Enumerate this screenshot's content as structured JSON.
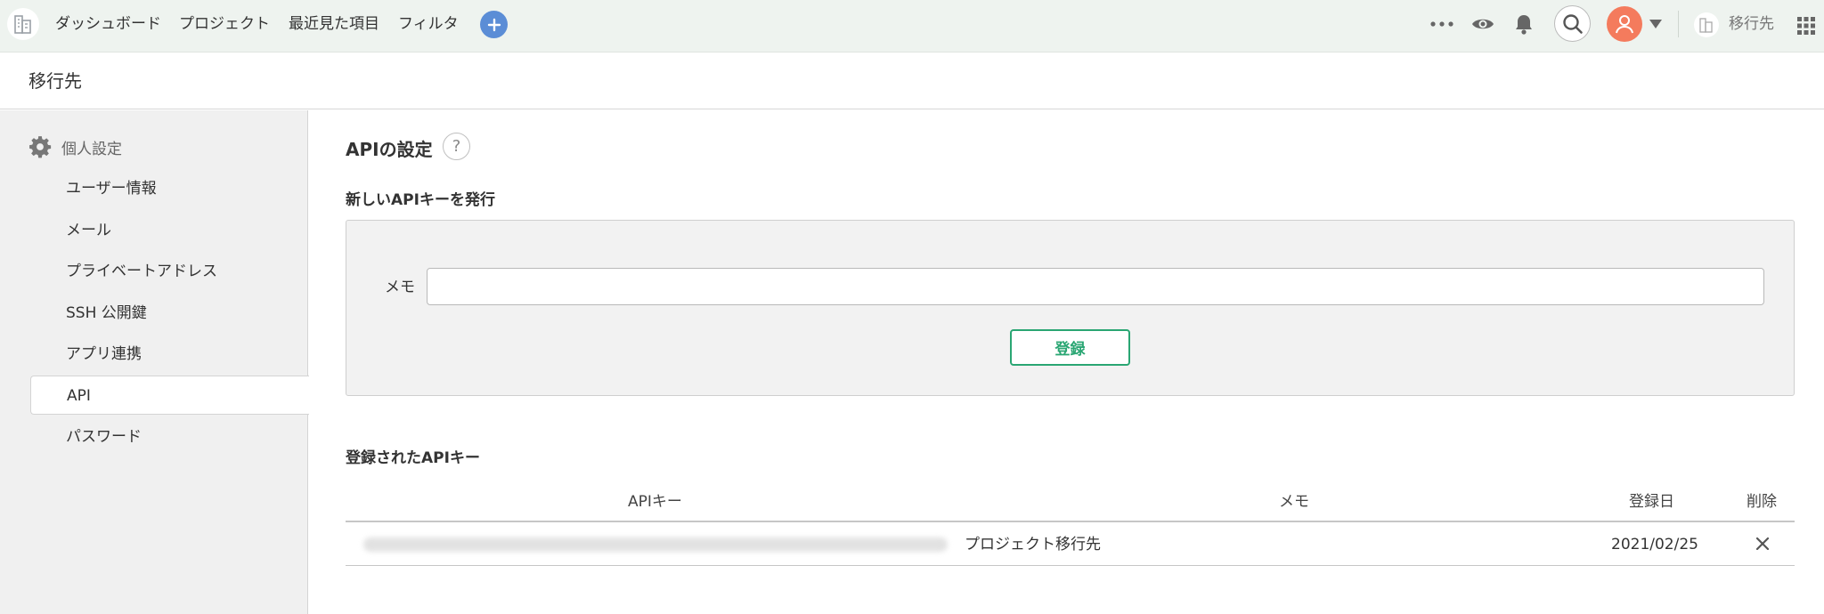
{
  "topbar": {
    "nav": [
      "ダッシュボード",
      "プロジェクト",
      "最近見た項目",
      "フィルタ"
    ],
    "project_name": "移行先",
    "icons": [
      "space-logo-icon",
      "add-icon",
      "more-icon",
      "watch-icon",
      "bell-icon",
      "search-icon",
      "user-avatar-icon",
      "chevron-down-icon",
      "project-icon",
      "apps-grid-icon"
    ]
  },
  "page": {
    "title": "移行先"
  },
  "sidebar": {
    "section": "個人設定",
    "items": [
      {
        "label": "ユーザー情報"
      },
      {
        "label": "メール"
      },
      {
        "label": "プライベートアドレス"
      },
      {
        "label": "SSH 公開鍵"
      },
      {
        "label": "アプリ連携"
      },
      {
        "label": "API"
      },
      {
        "label": "パスワード"
      }
    ],
    "active_index": 5
  },
  "main": {
    "title": "APIの設定",
    "help": "?",
    "new_key": {
      "heading": "新しいAPIキーを発行",
      "memo_label": "メモ",
      "memo_value": "",
      "register_label": "登録"
    },
    "registered": {
      "heading": "登録されたAPIキー",
      "columns": [
        "APIキー",
        "メモ",
        "登録日",
        "削除"
      ],
      "rows": [
        {
          "memo": "プロジェクト移行先",
          "date": "2021/02/25"
        }
      ]
    }
  },
  "colors": {
    "topbar_bg": "#eef3ef",
    "accent_green": "#2aa673",
    "plus_blue": "#5b8dd6",
    "avatar_orange": "#f47b5d",
    "sidebar_bg": "#f0f0f0"
  }
}
